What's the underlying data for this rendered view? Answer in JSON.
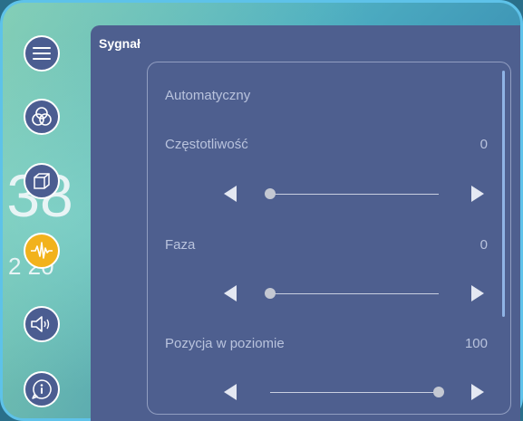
{
  "background": {
    "clock": ":38",
    "date": "2 20"
  },
  "panel": {
    "title": "Sygnał"
  },
  "settings": {
    "auto_label": "Automatyczny",
    "rows": [
      {
        "label": "Częstotliwość",
        "value": "0",
        "level": 0
      },
      {
        "label": "Faza",
        "value": "0",
        "level": 0
      },
      {
        "label": "Pozycja w poziomie",
        "value": "100",
        "level": 1
      }
    ]
  },
  "nav": {
    "items": [
      "menu-icon",
      "color-circles-icon",
      "cube-icon",
      "waveform-icon",
      "speaker-icon",
      "info-icon"
    ],
    "active": "waveform-icon"
  },
  "colors": {
    "panel": "#4e5f8f",
    "accent": "#f2b21c",
    "frame": "#5ec2e9"
  }
}
